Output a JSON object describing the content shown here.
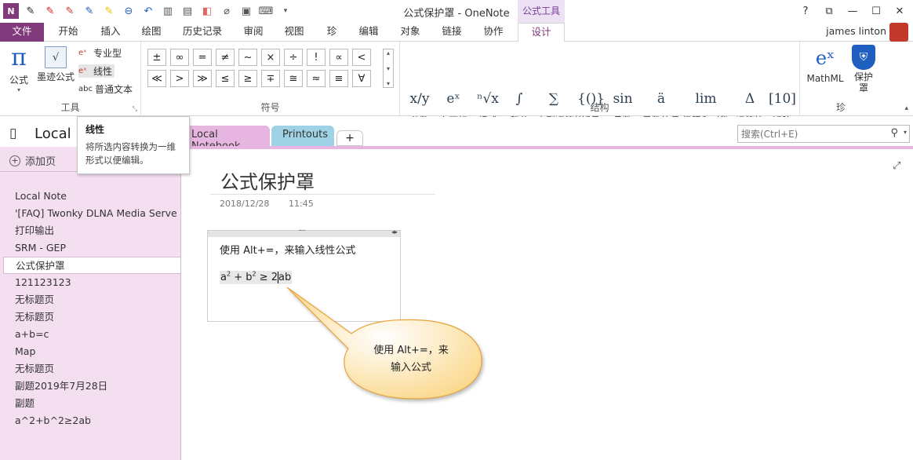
{
  "window": {
    "title": "公式保护罩 - OneNote",
    "context_group": "公式工具"
  },
  "tabs": [
    "文件",
    "开始",
    "插入",
    "绘图",
    "历史记录",
    "审阅",
    "视图",
    "珍",
    "编辑",
    "对象",
    "链接",
    "协作",
    "设计"
  ],
  "user": {
    "name": "james linton"
  },
  "ribbon": {
    "tools": {
      "label": "工具",
      "formula": "公式",
      "ink": "墨迹公式",
      "professional": "专业型",
      "linear": "线性",
      "normal_text": "普通文本",
      "normal_text_prefix": "abc"
    },
    "symbols": {
      "label": "符号",
      "items": [
        "±",
        "∞",
        "=",
        "≠",
        "~",
        "×",
        "÷",
        "!",
        "∝",
        "<",
        "≪",
        ">",
        "≫",
        "≤",
        "≥",
        "∓",
        "≅",
        "≈",
        "≡",
        "∀"
      ]
    },
    "structures": {
      "label": "结构",
      "items": [
        {
          "glyph": "x/y",
          "label": "分数"
        },
        {
          "glyph": "eˣ",
          "label": "上下标"
        },
        {
          "glyph": "ⁿ√x",
          "label": "根式"
        },
        {
          "glyph": "∫",
          "label": "积分"
        },
        {
          "glyph": "∑",
          "label": "大型运算符"
        },
        {
          "glyph": "{()}",
          "label": "括号"
        },
        {
          "glyph": "sin θ",
          "label": "函数"
        },
        {
          "glyph": "ä",
          "label": "导数符号"
        },
        {
          "glyph": "lim",
          "label": "极限和对数"
        },
        {
          "glyph": "Δ",
          "label": "运算符"
        },
        {
          "glyph": "[10]",
          "label": "矩阵"
        }
      ]
    },
    "zhen": {
      "label": "珍",
      "mathml": "MathML",
      "protect": "保护罩"
    }
  },
  "tooltip": {
    "title": "线性",
    "body_line1": "将所选内容转换为一维",
    "body_line2": "形式以便编辑。"
  },
  "notebook": {
    "name": "Local",
    "sections": [
      "Local Notebook",
      "Printouts"
    ],
    "add_section": "+"
  },
  "search": {
    "placeholder": "搜索(Ctrl+E)"
  },
  "sidebar": {
    "add_page": "添加页",
    "pages": [
      "Local Note",
      "'[FAQ] Twonky DLNA Media Serve",
      "打印输出",
      "SRM - GEP",
      "公式保护罩",
      "121123123",
      "无标题页",
      "无标题页",
      "a+b=c",
      "Map",
      "无标题页",
      "副题2019年7月28日",
      "副题",
      "a^2+b^2≥2ab"
    ],
    "selected_index": 4
  },
  "page": {
    "title": "公式保护罩",
    "date": "2018/12/28",
    "time": "11:45",
    "note_line": "使用 Alt+=，来输入线性公式",
    "formula_a": "a",
    "formula_b": " + b",
    "formula_rest": " ≥ 2",
    "formula_end": "ab",
    "sup": "2"
  },
  "callout": {
    "line1": "使用 Alt+=，来",
    "line2": "输入公式"
  },
  "colors": {
    "accent": "#80397b",
    "section_local": "#e6b6e0",
    "section_printouts": "#9fd2e4",
    "sidebar_bg": "#f4dff1",
    "callout_fill": "#fde5a8",
    "callout_border": "#e8a33b"
  }
}
